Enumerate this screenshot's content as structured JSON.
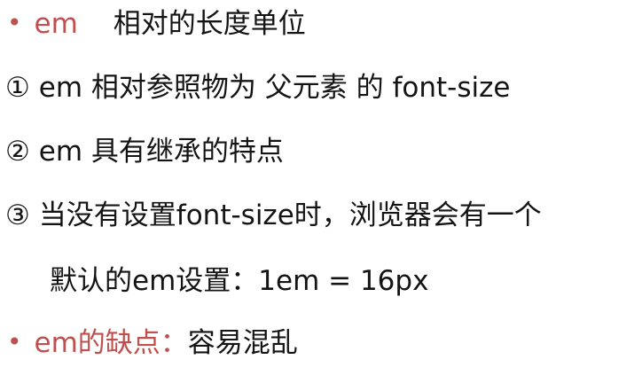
{
  "slide": {
    "line1": {
      "bullet": "•",
      "term": "em",
      "text": "相对的长度单位"
    },
    "line2": {
      "num": "①",
      "text": "em 相对参照物为 父元素 的 font-size"
    },
    "line3": {
      "num": "②",
      "text": "em 具有继承的特点"
    },
    "line4": {
      "num": "③",
      "text": "当没有设置font-size时，浏览器会有一个"
    },
    "line5": {
      "text": "默认的em设置：1em = 16px"
    },
    "line6": {
      "bullet": "•",
      "term": "em的缺点：",
      "text": "容易混乱"
    }
  },
  "colors": {
    "accent": "#c0504d",
    "text": "#141414"
  }
}
